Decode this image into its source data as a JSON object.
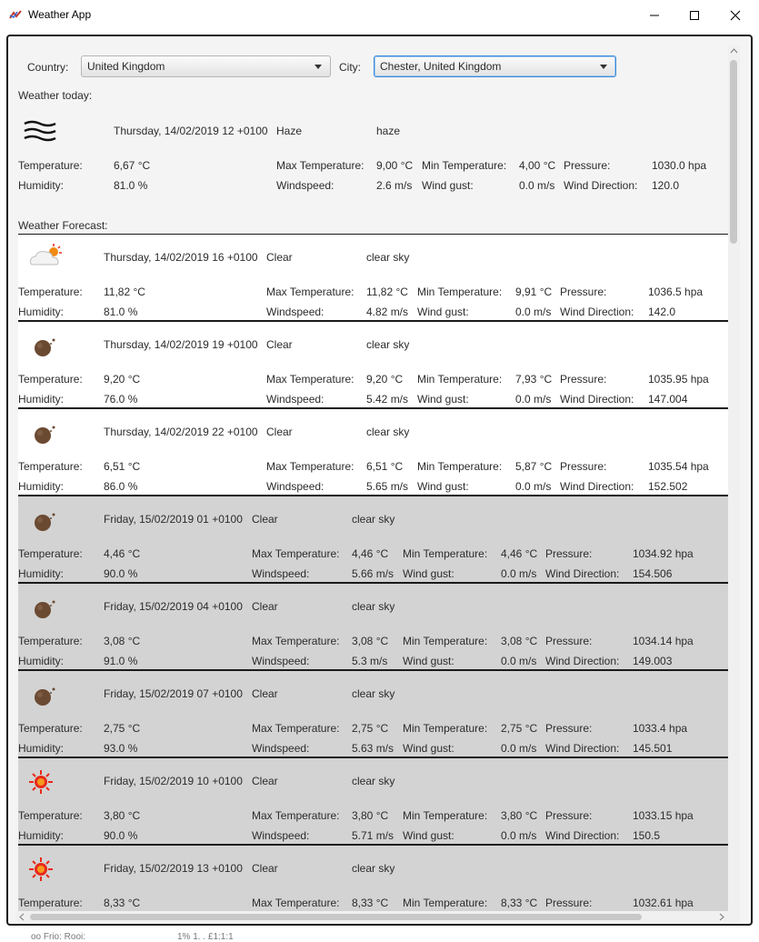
{
  "window": {
    "title": "Weather App"
  },
  "selectors": {
    "country_label": "Country:",
    "country_value": "United Kingdom",
    "city_label": "City:",
    "city_value": "Chester, United Kingdom"
  },
  "today": {
    "section_label": "Weather today:",
    "icon": "haze-icon",
    "date": "Thursday, 14/02/2019 12 +0100",
    "condition": "Haze",
    "description": "haze",
    "temperature": "6,67 °C",
    "max_temperature": "9,00 °C",
    "min_temperature": "4,00 °C",
    "pressure": "1030.0 hpa",
    "humidity": "81.0 %",
    "windspeed": "2.6 m/s",
    "wind_gust": "0.0 m/s",
    "wind_direction": "120.0"
  },
  "labels": {
    "temperature": "Temperature:",
    "max_temperature": "Max Temperature:",
    "min_temperature": "Min Temperature:",
    "pressure": "Pressure:",
    "humidity": "Humidity:",
    "windspeed": "Windspeed:",
    "wind_gust": "Wind gust:",
    "wind_direction": "Wind Direction:"
  },
  "forecast_label": "Weather Forecast:",
  "forecast": [
    {
      "icon": "cloud-sun-icon",
      "day": "thu",
      "date": "Thursday, 14/02/2019 16 +0100",
      "condition": "Clear",
      "description": "clear sky",
      "temperature": "11,82 °C",
      "max_temperature": "11,82 °C",
      "min_temperature": "9,91 °C",
      "pressure": "1036.5 hpa",
      "humidity": "81.0 %",
      "windspeed": "4.82 m/s",
      "wind_gust": "0.0 m/s",
      "wind_direction": "142.0"
    },
    {
      "icon": "moon-icon",
      "day": "thu",
      "date": "Thursday, 14/02/2019 19 +0100",
      "condition": "Clear",
      "description": "clear sky",
      "temperature": "9,20 °C",
      "max_temperature": "9,20 °C",
      "min_temperature": "7,93 °C",
      "pressure": "1035.95 hpa",
      "humidity": "76.0 %",
      "windspeed": "5.42 m/s",
      "wind_gust": "0.0 m/s",
      "wind_direction": "147.004"
    },
    {
      "icon": "moon-icon",
      "day": "thu",
      "date": "Thursday, 14/02/2019 22 +0100",
      "condition": "Clear",
      "description": "clear sky",
      "temperature": "6,51 °C",
      "max_temperature": "6,51 °C",
      "min_temperature": "5,87 °C",
      "pressure": "1035.54 hpa",
      "humidity": "86.0 %",
      "windspeed": "5.65 m/s",
      "wind_gust": "0.0 m/s",
      "wind_direction": "152.502"
    },
    {
      "icon": "moon-icon",
      "day": "fri",
      "date": "Friday, 15/02/2019 01 +0100",
      "condition": "Clear",
      "description": "clear sky",
      "temperature": "4,46 °C",
      "max_temperature": "4,46 °C",
      "min_temperature": "4,46 °C",
      "pressure": "1034.92 hpa",
      "humidity": "90.0 %",
      "windspeed": "5.66 m/s",
      "wind_gust": "0.0 m/s",
      "wind_direction": "154.506"
    },
    {
      "icon": "moon-icon",
      "day": "fri",
      "date": "Friday, 15/02/2019 04 +0100",
      "condition": "Clear",
      "description": "clear sky",
      "temperature": "3,08 °C",
      "max_temperature": "3,08 °C",
      "min_temperature": "3,08 °C",
      "pressure": "1034.14 hpa",
      "humidity": "91.0 %",
      "windspeed": "5.3 m/s",
      "wind_gust": "0.0 m/s",
      "wind_direction": "149.003"
    },
    {
      "icon": "moon-icon",
      "day": "fri",
      "date": "Friday, 15/02/2019 07 +0100",
      "condition": "Clear",
      "description": "clear sky",
      "temperature": "2,75 °C",
      "max_temperature": "2,75 °C",
      "min_temperature": "2,75 °C",
      "pressure": "1033.4 hpa",
      "humidity": "93.0 %",
      "windspeed": "5.63 m/s",
      "wind_gust": "0.0 m/s",
      "wind_direction": "145.501"
    },
    {
      "icon": "sun-icon",
      "day": "fri",
      "date": "Friday, 15/02/2019 10 +0100",
      "condition": "Clear",
      "description": "clear sky",
      "temperature": "3,80 °C",
      "max_temperature": "3,80 °C",
      "min_temperature": "3,80 °C",
      "pressure": "1033.15 hpa",
      "humidity": "90.0 %",
      "windspeed": "5.71 m/s",
      "wind_gust": "0.0 m/s",
      "wind_direction": "150.5"
    },
    {
      "icon": "sun-icon",
      "day": "fri",
      "date": "Friday, 15/02/2019 13 +0100",
      "condition": "Clear",
      "description": "clear sky",
      "temperature": "8,33 °C",
      "max_temperature": "8,33 °C",
      "min_temperature": "8,33 °C",
      "pressure": "1032.61 hpa",
      "humidity": "",
      "windspeed": "",
      "wind_gust": "",
      "wind_direction": ""
    }
  ],
  "background_fragment": {
    "left": "oo Frio: Rooi:",
    "right": "1% 1. . £1:1:1"
  },
  "colors": {
    "white_card": "#ffffff",
    "gray_card": "#d3d3d3",
    "focus_border": "#3b8ad8",
    "sun": "#e8291b",
    "moon": "#6b4a32"
  }
}
